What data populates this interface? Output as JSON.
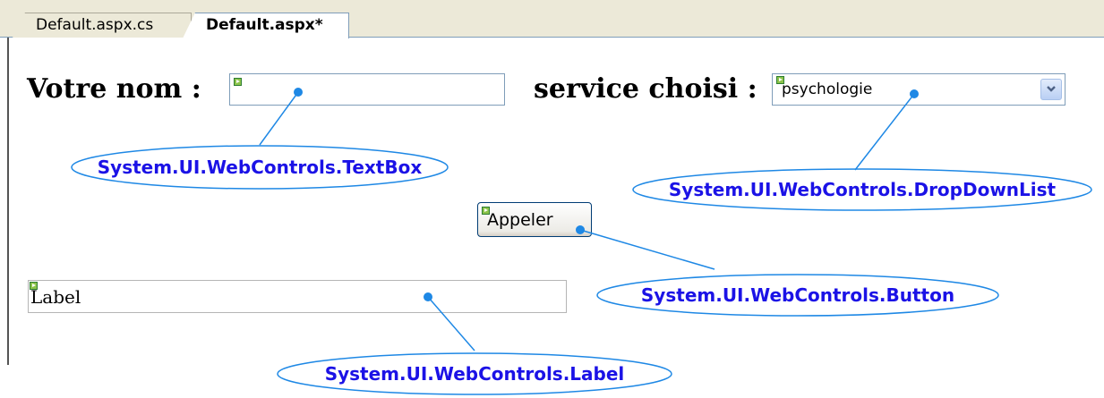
{
  "tabs": [
    {
      "label": "Default.aspx.cs",
      "active": false
    },
    {
      "label": "Default.aspx*",
      "active": true
    }
  ],
  "form": {
    "name_label": "Votre nom :",
    "name_value": "",
    "service_label": "service choisi :",
    "service_selected": "psychologie",
    "button_label": "Appeler",
    "label_text": "Label"
  },
  "callouts": {
    "textbox": "System.UI.WebControls.TextBox",
    "dropdown": "System.UI.WebControls.DropDownList",
    "button": "System.UI.WebControls.Button",
    "label": "System.UI.WebControls.Label"
  },
  "colors": {
    "callout_text": "#1b12e6",
    "callout_line": "#1e88e5",
    "glyph": "#8bc34a"
  },
  "icons": {
    "control_glyph": "green-run-arrow-icon",
    "dropdown_arrow": "chevron-down-icon"
  }
}
